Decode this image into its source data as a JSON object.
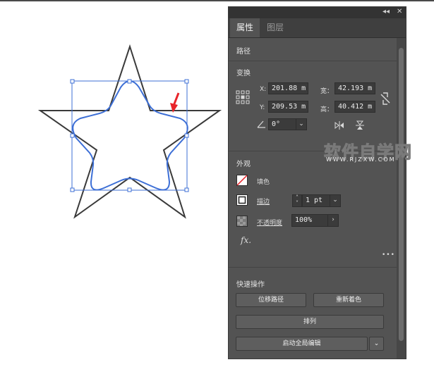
{
  "panel": {
    "tabs": [
      {
        "label": "属性"
      },
      {
        "label": "图层"
      }
    ],
    "titlebar": {
      "collapse": "◂◂",
      "close": "✕"
    },
    "path_section": {
      "title": "路径"
    },
    "transform": {
      "title": "变换",
      "x_label": "X:",
      "x_value": "201.88 m",
      "y_label": "Y:",
      "y_value": "209.53 m",
      "w_label": "宽：",
      "w_value": "42.193 m",
      "h_label": "高：",
      "h_value": "40.412 m",
      "angle_value": "0°"
    },
    "appearance": {
      "title": "外观",
      "fill_label": "填色",
      "stroke_label": "描边",
      "stroke_value": "1 pt",
      "opacity_label": "不透明度",
      "opacity_value": "100%",
      "fx_label": "fx.",
      "more": "•••"
    },
    "quick_actions": {
      "title": "快速操作",
      "offset_path": "位移路径",
      "recolor": "重新着色",
      "arrange": "排列",
      "global_edit": "启动全局编辑"
    }
  },
  "watermark": {
    "main": "软件自学网",
    "sub": "WWW.RJZXW.COM"
  },
  "colors": {
    "selection": "#3d6fd6",
    "outer_star": "#3a3a3a",
    "arrow": "#e8242a",
    "panel_bg": "#535353"
  }
}
